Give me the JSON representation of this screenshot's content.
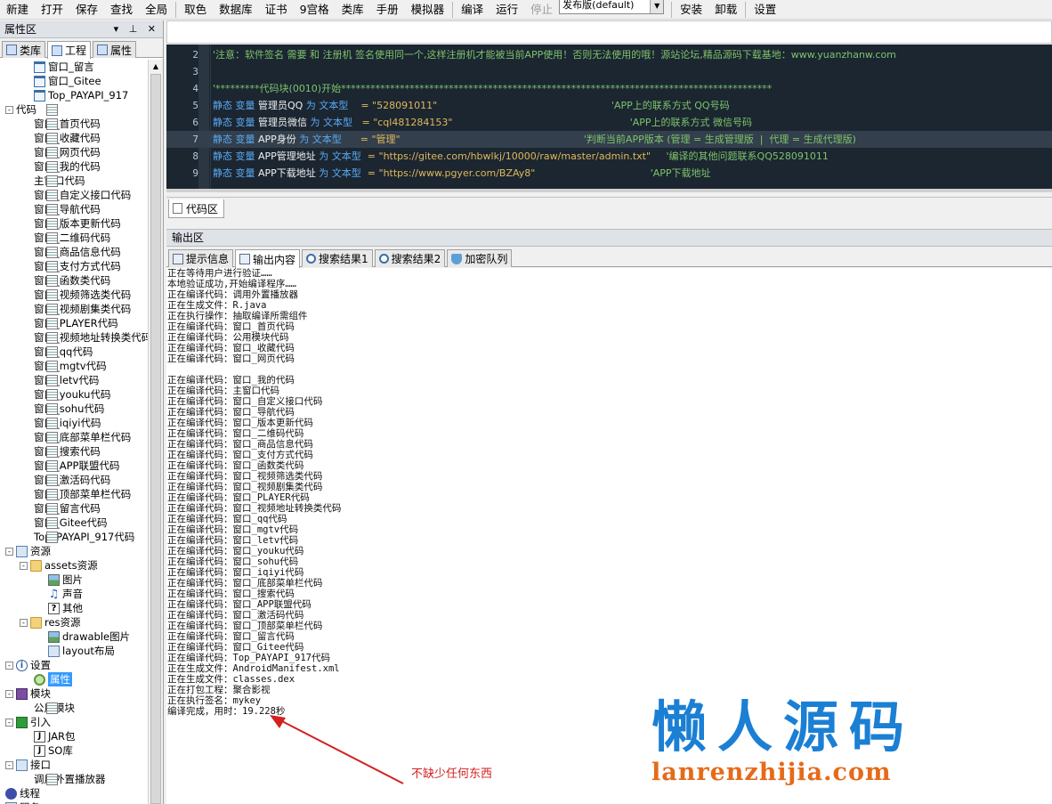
{
  "toolbar": {
    "items": [
      "新建",
      "打开",
      "保存",
      "查找",
      "全局",
      "取色",
      "数据库",
      "证书",
      "9宫格",
      "类库",
      "手册",
      "模拟器",
      "编译",
      "运行",
      "停止",
      "安装",
      "卸载",
      "设置"
    ],
    "disabled": "停止",
    "build_mode": "发布版(default)"
  },
  "left_panel": {
    "title": "属性区",
    "controls": "▾ ⊥ ✕",
    "tabs": [
      "类库",
      "工程",
      "属性"
    ]
  },
  "tree": [
    {
      "label": "窗口_留言",
      "icon": "form",
      "level": 2
    },
    {
      "label": "窗口_Gitee",
      "icon": "form",
      "level": 2
    },
    {
      "label": "Top_PAYAPI_917",
      "icon": "form",
      "level": 2
    },
    {
      "label": "代码",
      "icon": "code",
      "level": 0,
      "exp": "-"
    },
    {
      "label": "窗口_首页代码",
      "icon": "code",
      "level": 2
    },
    {
      "label": "窗口_收藏代码",
      "icon": "code",
      "level": 2
    },
    {
      "label": "窗口_网页代码",
      "icon": "code",
      "level": 2
    },
    {
      "label": "窗口_我的代码",
      "icon": "code",
      "level": 2
    },
    {
      "label": "主窗口代码",
      "icon": "code",
      "level": 2
    },
    {
      "label": "窗口_自定义接口代码",
      "icon": "code",
      "level": 2
    },
    {
      "label": "窗口_导航代码",
      "icon": "code",
      "level": 2
    },
    {
      "label": "窗口_版本更新代码",
      "icon": "code",
      "level": 2
    },
    {
      "label": "窗口_二维码代码",
      "icon": "code",
      "level": 2
    },
    {
      "label": "窗口_商品信息代码",
      "icon": "code",
      "level": 2
    },
    {
      "label": "窗口_支付方式代码",
      "icon": "code",
      "level": 2
    },
    {
      "label": "窗口_函数类代码",
      "icon": "code",
      "level": 2
    },
    {
      "label": "窗口_视频筛选类代码",
      "icon": "code",
      "level": 2
    },
    {
      "label": "窗口_视频剧集类代码",
      "icon": "code",
      "level": 2
    },
    {
      "label": "窗口_PLAYER代码",
      "icon": "code",
      "level": 2
    },
    {
      "label": "窗口_视频地址转换类代码",
      "icon": "code",
      "level": 2
    },
    {
      "label": "窗口_qq代码",
      "icon": "code",
      "level": 2
    },
    {
      "label": "窗口_mgtv代码",
      "icon": "code",
      "level": 2
    },
    {
      "label": "窗口_letv代码",
      "icon": "code",
      "level": 2
    },
    {
      "label": "窗口_youku代码",
      "icon": "code",
      "level": 2
    },
    {
      "label": "窗口_sohu代码",
      "icon": "code",
      "level": 2
    },
    {
      "label": "窗口_iqiyi代码",
      "icon": "code",
      "level": 2
    },
    {
      "label": "窗口_底部菜单栏代码",
      "icon": "code",
      "level": 2
    },
    {
      "label": "窗口_搜索代码",
      "icon": "code",
      "level": 2
    },
    {
      "label": "窗口_APP联盟代码",
      "icon": "code",
      "level": 2
    },
    {
      "label": "窗口_激活码代码",
      "icon": "code",
      "level": 2
    },
    {
      "label": "窗口_顶部菜单栏代码",
      "icon": "code",
      "level": 2
    },
    {
      "label": "窗口_留言代码",
      "icon": "code",
      "level": 2
    },
    {
      "label": "窗口_Gitee代码",
      "icon": "code",
      "level": 2
    },
    {
      "label": "Top_PAYAPI_917代码",
      "icon": "code",
      "level": 2
    },
    {
      "label": "资源",
      "icon": "res",
      "level": 0,
      "exp": "-"
    },
    {
      "label": "assets资源",
      "icon": "folder",
      "level": 1,
      "exp": "-"
    },
    {
      "label": "图片",
      "icon": "img",
      "level": 3
    },
    {
      "label": "声音",
      "icon": "note",
      "level": 3
    },
    {
      "label": "其他",
      "icon": "q",
      "level": 3
    },
    {
      "label": "res资源",
      "icon": "folder",
      "level": 1,
      "exp": "-"
    },
    {
      "label": "drawable图片",
      "icon": "img",
      "level": 3
    },
    {
      "label": "layout布局",
      "icon": "res",
      "level": 3
    },
    {
      "label": "设置",
      "icon": "info",
      "level": 0,
      "exp": "-"
    },
    {
      "label": "属性",
      "icon": "gear",
      "level": 2,
      "selected": true
    },
    {
      "label": "模块",
      "icon": "mod",
      "level": 0,
      "exp": "-"
    },
    {
      "label": "公用模块",
      "icon": "code",
      "level": 2
    },
    {
      "label": "引入",
      "icon": "imp",
      "level": 0,
      "exp": "-"
    },
    {
      "label": "JAR包",
      "icon": "jar",
      "level": 2
    },
    {
      "label": "SO库",
      "icon": "jar",
      "level": 2
    },
    {
      "label": "接口",
      "icon": "res",
      "level": 0,
      "exp": "-"
    },
    {
      "label": "调用外置播放器",
      "icon": "code",
      "level": 2
    },
    {
      "label": "线程",
      "icon": "thread",
      "level": 0
    },
    {
      "label": "服务",
      "icon": "res",
      "level": 0
    }
  ],
  "editor": {
    "lines": [
      {
        "n": "2",
        "parts": [
          {
            "t": "'注意：软件签名 需要 和 注册机 签名使用同一个,这样注册机才能被当前APP使用！否则无法使用的哦！源站论坛,精品源码下载基地：www.yuanzhanw.com",
            "c": "cm"
          }
        ]
      },
      {
        "n": "3",
        "parts": []
      },
      {
        "n": "4",
        "parts": [
          {
            "t": "'*********代码块(0010)开始****************************************************************************************",
            "c": "cm"
          }
        ]
      },
      {
        "n": "5",
        "parts": [
          {
            "t": "静态 变量 ",
            "c": "kw"
          },
          {
            "t": "管理员QQ ",
            "c": "id"
          },
          {
            "t": "为 文本型",
            "c": "kw"
          },
          {
            "t": "    = \"528091011\"",
            "c": "str"
          },
          {
            "t": "                                                        'APP上的联系方式 QQ号码",
            "c": "cm"
          }
        ]
      },
      {
        "n": "6",
        "parts": [
          {
            "t": "静态 变量 ",
            "c": "kw"
          },
          {
            "t": "管理员微信 ",
            "c": "id"
          },
          {
            "t": "为 文本型",
            "c": "kw"
          },
          {
            "t": "   = \"cql481284153\"",
            "c": "str"
          },
          {
            "t": "                                                         'APP上的联系方式 微信号码",
            "c": "cm"
          }
        ]
      },
      {
        "n": "7",
        "parts": [
          {
            "t": "静态 变量 ",
            "c": "kw"
          },
          {
            "t": "APP身份 ",
            "c": "id"
          },
          {
            "t": "为 文本型",
            "c": "kw"
          },
          {
            "t": "      = \"管理\"",
            "c": "str"
          },
          {
            "t": "                                                           '判断当前APP版本 (管理 = 生成管理版  |  代理 = 生成代理版)",
            "c": "cm"
          }
        ],
        "hl": true
      },
      {
        "n": "8",
        "parts": [
          {
            "t": "静态 变量 ",
            "c": "kw"
          },
          {
            "t": "APP管理地址 ",
            "c": "id"
          },
          {
            "t": "为 文本型",
            "c": "kw"
          },
          {
            "t": "  = \"https://gitee.com/hbwlkj/10000/raw/master/admin.txt\"",
            "c": "str"
          },
          {
            "t": "     '编译的其他问题联系QQ528091011",
            "c": "cm"
          }
        ]
      },
      {
        "n": "9",
        "parts": [
          {
            "t": "静态 变量 ",
            "c": "kw"
          },
          {
            "t": "APP下载地址 ",
            "c": "id"
          },
          {
            "t": "为 文本型",
            "c": "kw"
          },
          {
            "t": "  = \"https://www.pgyer.com/BZAy8\"",
            "c": "str"
          },
          {
            "t": "                                     'APP下载地址",
            "c": "cm"
          }
        ]
      }
    ]
  },
  "editor_tab": "代码区",
  "output_title": "输出区",
  "output_tabs": [
    {
      "label": "提示信息",
      "icon": "msg"
    },
    {
      "label": "输出内容",
      "icon": "doc",
      "active": true
    },
    {
      "label": "搜索结果1",
      "icon": "srch"
    },
    {
      "label": "搜索结果2",
      "icon": "srch"
    },
    {
      "label": "加密队列",
      "icon": "shield"
    }
  ],
  "output_lines": [
    "正在等待用户进行验证……",
    "本地验证成功,开始编译程序……",
    "正在编译代码：调用外置播放器",
    "正在生成文件：R.java",
    "正在执行操作：抽取编译所需组件",
    "正在编译代码：窗口_首页代码",
    "正在编译代码：公用模块代码",
    "正在编译代码：窗口_收藏代码",
    "正在编译代码：窗口_网页代码",
    "",
    "正在编译代码：窗口_我的代码",
    "正在编译代码：主窗口代码",
    "正在编译代码：窗口_自定义接口代码",
    "正在编译代码：窗口_导航代码",
    "正在编译代码：窗口_版本更新代码",
    "正在编译代码：窗口_二维码代码",
    "正在编译代码：窗口_商品信息代码",
    "正在编译代码：窗口_支付方式代码",
    "正在编译代码：窗口_函数类代码",
    "正在编译代码：窗口_视频筛选类代码",
    "正在编译代码：窗口_视频剧集类代码",
    "正在编译代码：窗口_PLAYER代码",
    "正在编译代码：窗口_视频地址转换类代码",
    "正在编译代码：窗口_qq代码",
    "正在编译代码：窗口_mgtv代码",
    "正在编译代码：窗口_letv代码",
    "正在编译代码：窗口_youku代码",
    "正在编译代码：窗口_sohu代码",
    "正在编译代码：窗口_iqiyi代码",
    "正在编译代码：窗口_底部菜单栏代码",
    "正在编译代码：窗口_搜索代码",
    "正在编译代码：窗口_APP联盟代码",
    "正在编译代码：窗口_激活码代码",
    "正在编译代码：窗口_顶部菜单栏代码",
    "正在编译代码：窗口_留言代码",
    "正在编译代码：窗口_Gitee代码",
    "正在编译代码：Top_PAYAPI_917代码",
    "正在生成文件：AndroidManifest.xml",
    "正在生成文件：classes.dex",
    "正在打包工程：聚合影视",
    "正在执行签名：mykey",
    "编译完成，用时：19.228秒"
  ],
  "annotation": "不缺少任何东西",
  "watermark": {
    "title": "懒人源码",
    "url": "lanrenzhijia.com"
  },
  "colors": {
    "accent": "#3399ff",
    "editor_bg": "#1b2631",
    "watermark_blue": "#1b7fd4",
    "watermark_orange": "#e56a1a",
    "annotation_red": "#d42020"
  }
}
